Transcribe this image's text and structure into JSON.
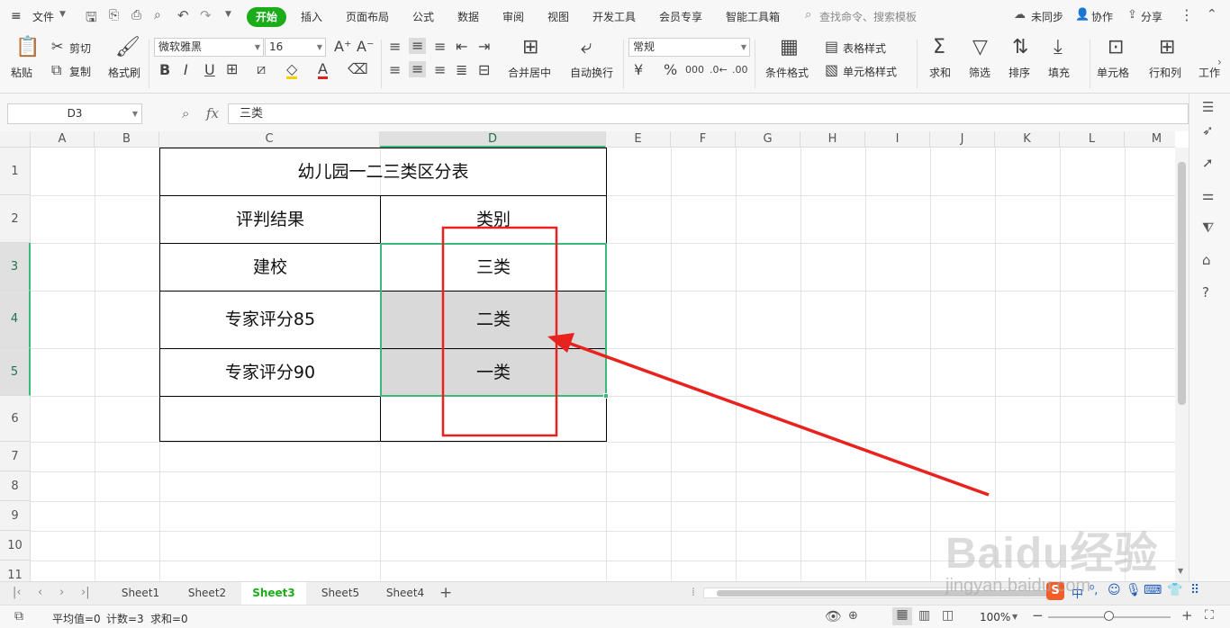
{
  "menubar": {
    "file_label": "文件",
    "tabs": [
      "开始",
      "插入",
      "页面布局",
      "公式",
      "数据",
      "审阅",
      "视图",
      "开发工具",
      "会员专享",
      "智能工具箱"
    ],
    "search_placeholder": "查找命令、搜索模板",
    "sync_label": "未同步",
    "collab_label": "协作",
    "share_label": "分享"
  },
  "ribbon": {
    "paste": "粘贴",
    "cut": "剪切",
    "copy": "复制",
    "format_painter": "格式刷",
    "font_name": "微软雅黑",
    "font_size": "16",
    "merge_center": "合并居中",
    "wrap_text": "自动换行",
    "number_format": "常规",
    "cond_format": "条件格式",
    "table_style": "表格样式",
    "cell_style": "单元格样式",
    "sum": "求和",
    "filter": "筛选",
    "sort": "排序",
    "fill": "填充",
    "cell": "单元格",
    "row_col": "行和列",
    "worksheet": "工作"
  },
  "formula_bar": {
    "name_box": "D3",
    "fx": "fx",
    "value": "三类"
  },
  "grid": {
    "columns": [
      "A",
      "B",
      "C",
      "D",
      "E",
      "F",
      "G",
      "H",
      "I",
      "J",
      "K",
      "L",
      "M"
    ],
    "rows": [
      "1",
      "2",
      "3",
      "4",
      "5",
      "6",
      "7",
      "8",
      "9",
      "10",
      "11"
    ],
    "selected_cell": "D3"
  },
  "table": {
    "title": "幼儿园一二三类区分表",
    "header_c": "评判结果",
    "header_d": "类别",
    "rows": [
      {
        "c": "建校",
        "d": "三类"
      },
      {
        "c": "专家评分85",
        "d": "二类"
      },
      {
        "c": "专家评分90",
        "d": "一类"
      }
    ]
  },
  "sheets": {
    "tabs": [
      "Sheet1",
      "Sheet2",
      "Sheet3",
      "Sheet5",
      "Sheet4"
    ],
    "active": "Sheet3"
  },
  "statusbar": {
    "average": "平均值=0",
    "count": "计数=3",
    "sum": "求和=0",
    "zoom": "100%"
  },
  "watermark": {
    "logo": "Baidu经验",
    "url": "jingyan.baidu.com"
  },
  "colors": {
    "accent": "#1aad19",
    "selection": "#3cb878",
    "annotation": "#e8231f",
    "highlight_fill": "#d9d9d9"
  }
}
